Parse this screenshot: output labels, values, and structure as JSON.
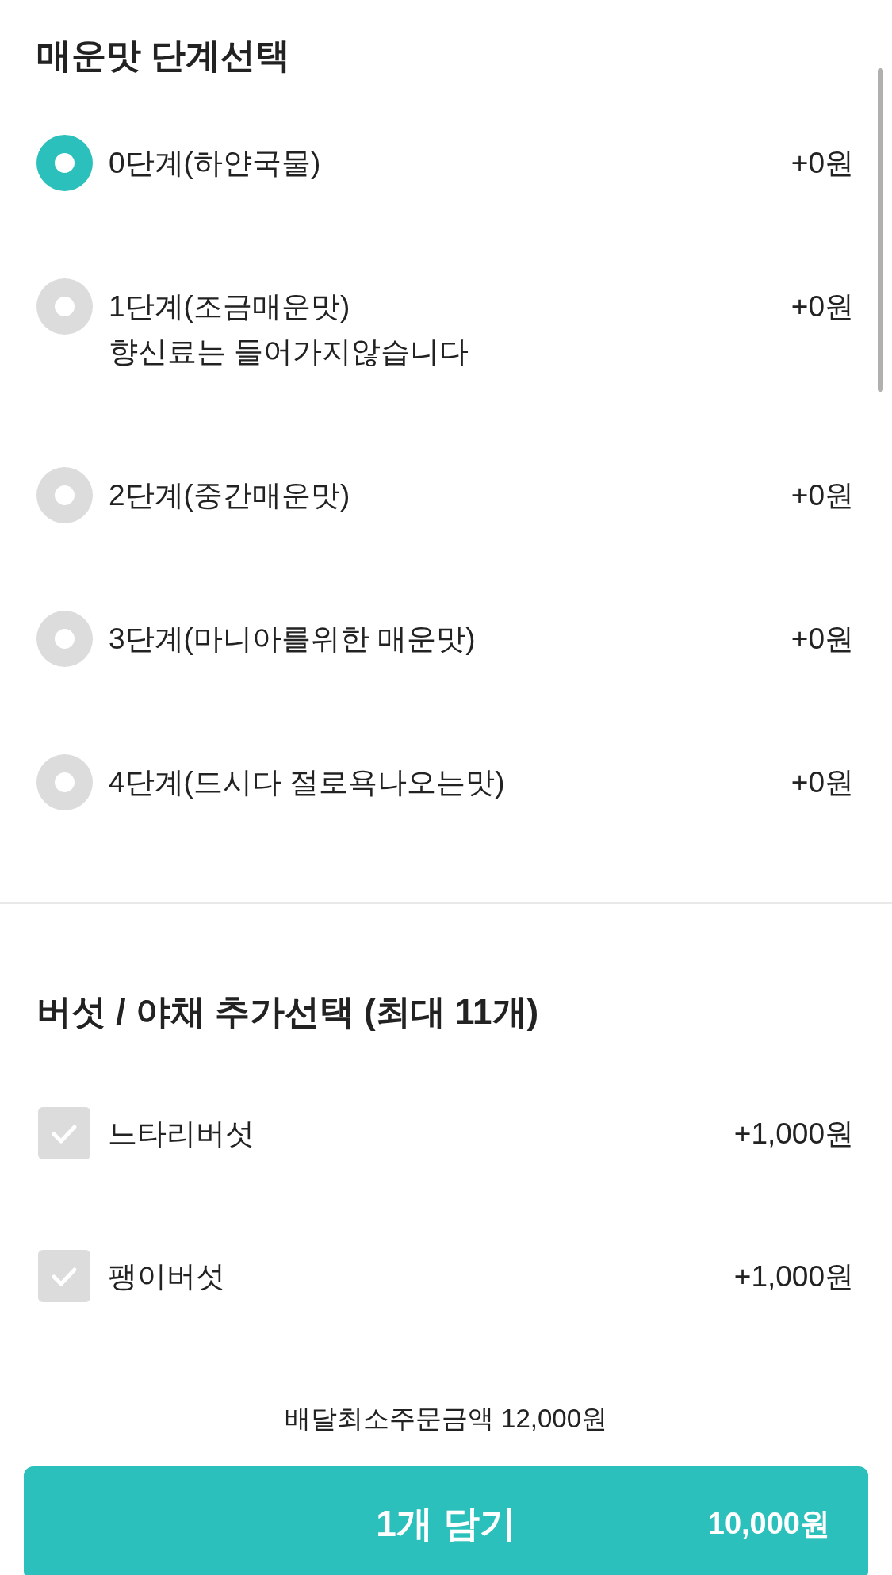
{
  "sections": [
    {
      "kind": "radio",
      "title": "매운맛 단계선택",
      "options": [
        {
          "label": "0단계(하얀국물)",
          "price": "+0원",
          "selected": true
        },
        {
          "label": "1단계(조금매운맛)",
          "description": "향신료는 들어가지않습니다",
          "price": "+0원",
          "selected": false
        },
        {
          "label": "2단계(중간매운맛)",
          "price": "+0원",
          "selected": false
        },
        {
          "label": "3단계(마니아를위한 매운맛)",
          "price": "+0원",
          "selected": false
        },
        {
          "label": "4단계(드시다 절로욕나오는맛)",
          "price": "+0원",
          "selected": false
        }
      ]
    },
    {
      "kind": "checkbox",
      "title": "버섯 / 야채 추가선택 (최대 11개)",
      "options": [
        {
          "label": "느타리버섯",
          "price": "+1,000원",
          "checked": false
        },
        {
          "label": "팽이버섯",
          "price": "+1,000원",
          "checked": false
        }
      ]
    }
  ],
  "min_order": "배달최소주문금액 12,000원",
  "cart_button": {
    "label": "1개 담기",
    "total": "10,000원"
  }
}
